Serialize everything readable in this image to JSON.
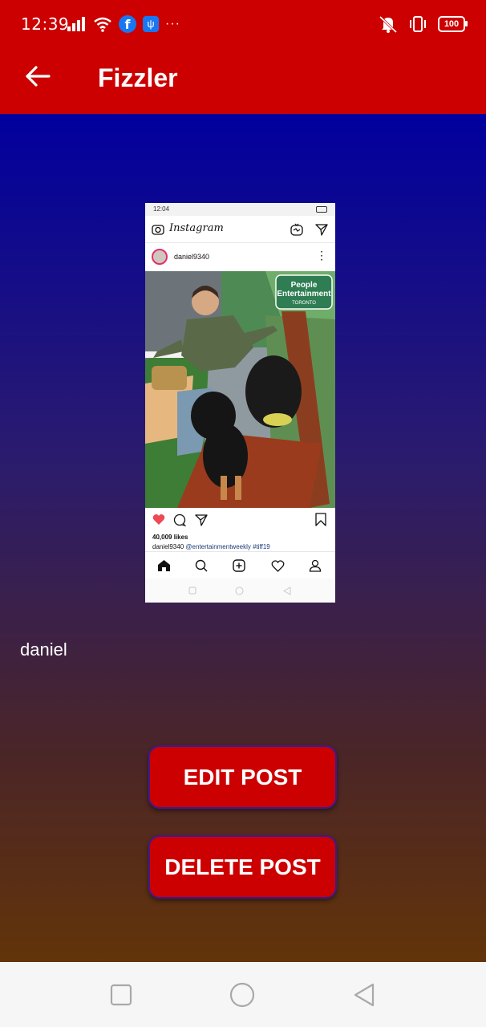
{
  "status_bar": {
    "time": "12:39",
    "battery": "100",
    "more": "···"
  },
  "app_bar": {
    "title": "Fizzler"
  },
  "post": {
    "image": {
      "status_time": "12:04",
      "app_logo": "Instagram",
      "username": "daniel9340",
      "likes": "40,009 likes",
      "caption_user": "daniel9340",
      "caption_text": "@entertainmentweekly #tiff19"
    },
    "caption": "daniel"
  },
  "actions": {
    "edit_label": "EDIT POST",
    "delete_label": "DELETE POST"
  },
  "colors": {
    "primary": "#cc0000",
    "gradient_top": "#01009e",
    "gradient_bottom": "#633409",
    "button_border": "#3d1a8f"
  },
  "icons": {
    "back": "arrow-left-icon",
    "signal": "signal-icon",
    "wifi": "wifi-icon",
    "facebook": "facebook-icon",
    "usb": "usb-icon",
    "mute": "vibrate-off-icon",
    "vibrate": "vibrate-icon",
    "nav_recent": "square-icon",
    "nav_home": "circle-icon",
    "nav_back": "triangle-back-icon"
  }
}
